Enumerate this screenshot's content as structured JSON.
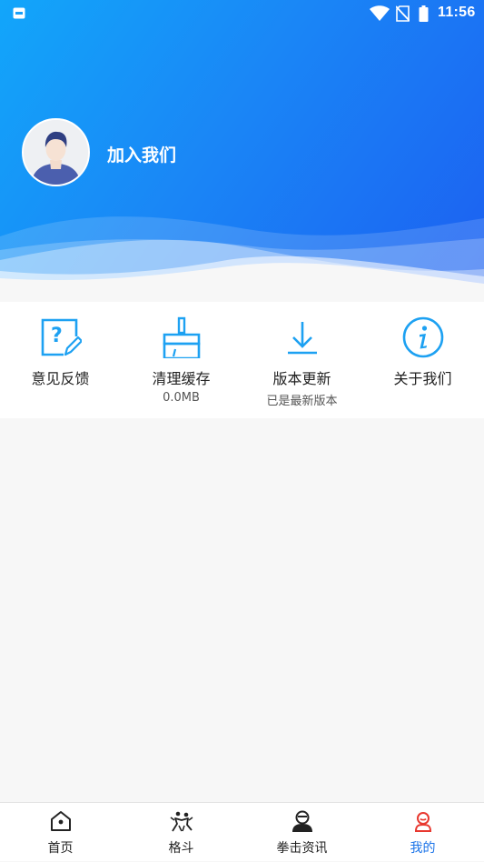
{
  "status_bar": {
    "time": "11:56",
    "icons": [
      "app-notification-icon",
      "wifi-icon",
      "no-sim-icon",
      "battery-icon"
    ]
  },
  "profile": {
    "join_label": "加入我们"
  },
  "menu": [
    {
      "label": "意见反馈",
      "sub": "",
      "icon": "feedback-icon"
    },
    {
      "label": "清理缓存",
      "sub": "0.0MB",
      "icon": "broom-icon"
    },
    {
      "label": "版本更新",
      "sub": "已是最新版本",
      "icon": "download-icon"
    },
    {
      "label": "关于我们",
      "sub": "",
      "icon": "info-icon"
    }
  ],
  "bottom_nav": [
    {
      "label": "首页",
      "icon": "home-icon",
      "active": false
    },
    {
      "label": "格斗",
      "icon": "fight-icon",
      "active": false
    },
    {
      "label": "拳击资讯",
      "icon": "boxer-icon",
      "active": false
    },
    {
      "label": "我的",
      "icon": "profile-icon",
      "active": true
    }
  ],
  "colors": {
    "header_start": "#12a6fa",
    "header_end": "#1c5ff1",
    "icon_blue": "#1da1f2",
    "active_tab": "#1a73e8",
    "active_tab_icon": "#e8382f"
  }
}
